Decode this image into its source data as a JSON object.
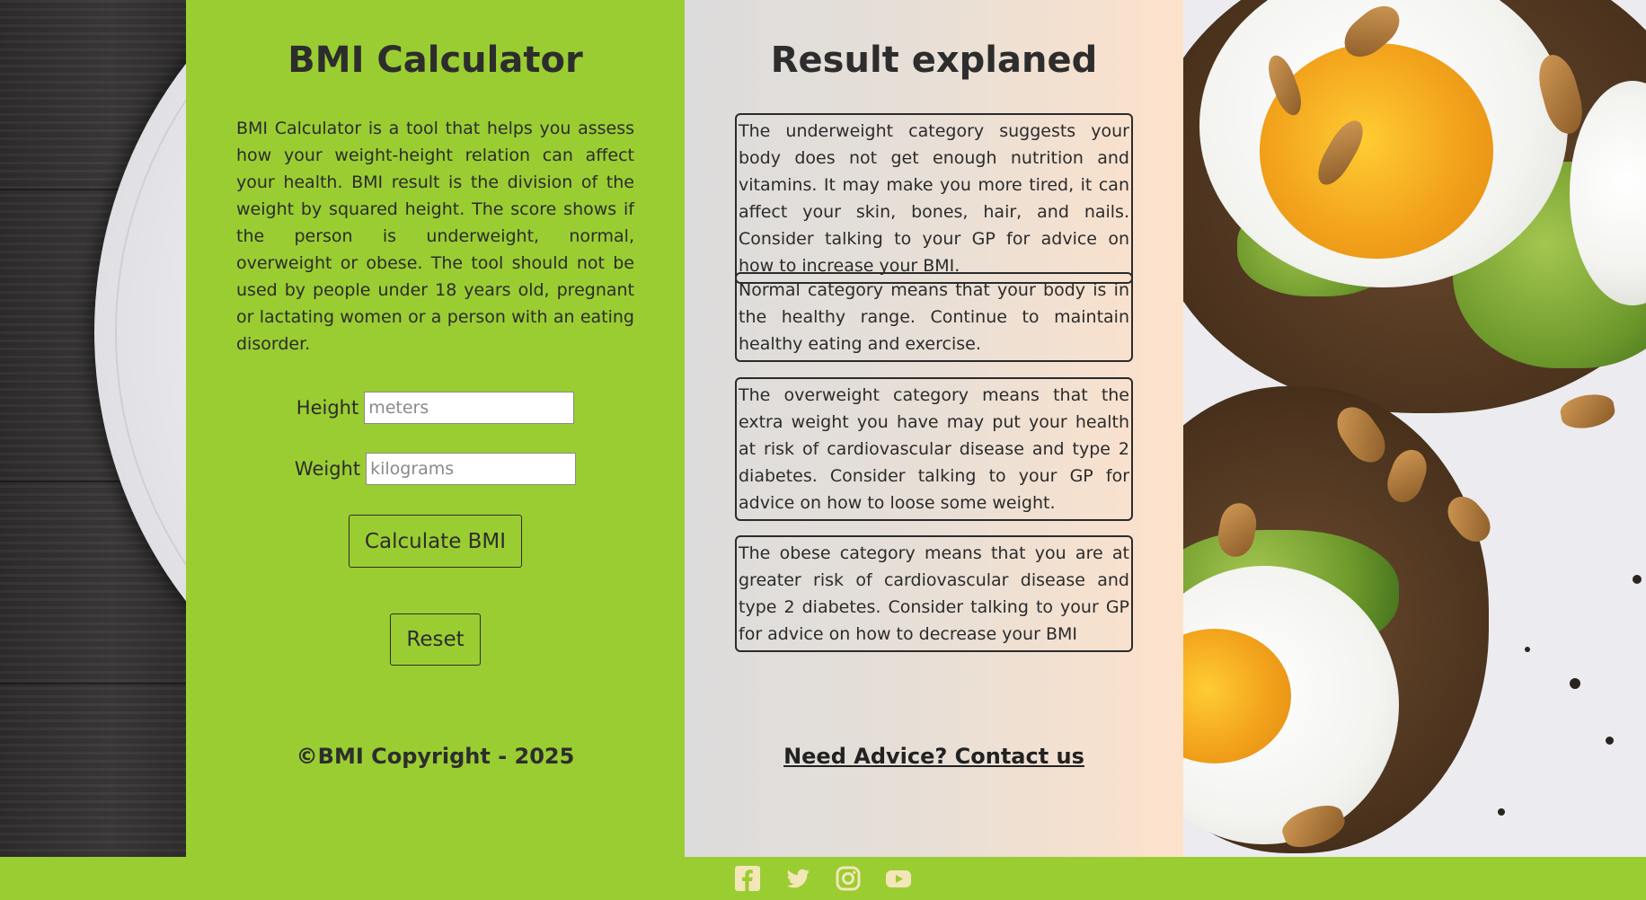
{
  "bmi": {
    "title": "BMI Calculator",
    "description": "BMI Calculator is a tool that helps you assess how your weight-height relation can affect your health. BMI result is the division of the weight by squared height. The score shows if the person is underweight, normal, overweight or obese. The tool should not be used by people under 18 years old, pregnant or lactating women or a person with an eating disorder.",
    "height_label": "Height",
    "height_placeholder": "meters",
    "height_value": "",
    "weight_label": "Weight",
    "weight_placeholder": "kilograms",
    "weight_value": "",
    "calculate_label": "Calculate BMI",
    "reset_label": "Reset",
    "copyright": "©BMI Copyright - 2025"
  },
  "results": {
    "title": "Result explaned",
    "categories": [
      {
        "text": "The underweight category suggests your body does not get enough nutrition and vitamins. It may make you more tired, it can affect your skin, bones, hair, and nails. Consider talking to your GP for advice on how to increase your BMI."
      },
      {
        "text": "Normal category means that your body is in the healthy range. Continue to maintain healthy eating and exercise."
      },
      {
        "text": "The overweight category means that the extra weight you have may put your health at risk of cardiovascular disease and type 2 diabetes. Consider talking to your GP for advice on how to loose some weight."
      },
      {
        "text": "The obese category means that you are at greater risk of cardiovascular disease and type 2 diabetes. Consider talking to your GP for advice on how to decrease your BMI"
      }
    ],
    "advice_link": "Need Advice? Contact us"
  },
  "footer": {
    "social": [
      {
        "name": "facebook-icon"
      },
      {
        "name": "twitter-icon"
      },
      {
        "name": "instagram-icon"
      },
      {
        "name": "youtube-icon"
      }
    ],
    "icon_color": "#f3e6b8"
  },
  "colors": {
    "panel_green": "#9acd32",
    "text_dark": "#2b2b2b"
  }
}
